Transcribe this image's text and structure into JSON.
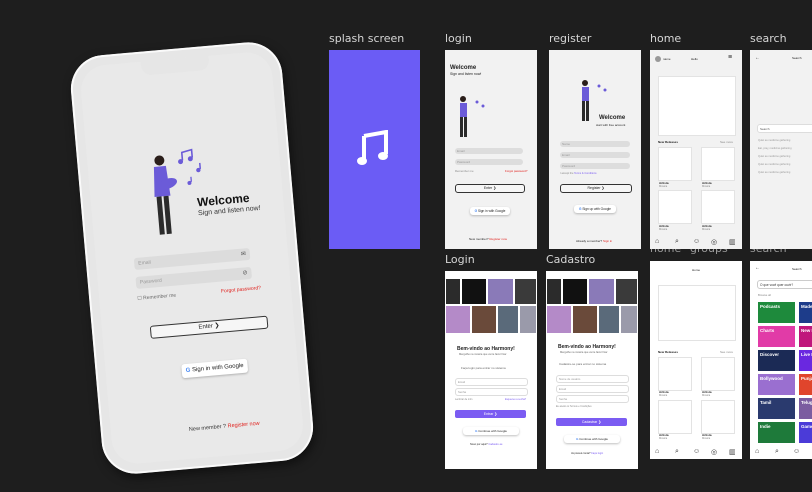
{
  "frame_labels": {
    "splash": "splash screen",
    "login": "login",
    "register": "register",
    "home": "home",
    "search": "search",
    "login2": "Login",
    "cadastro": "Cadastro",
    "home2": "home",
    "groups": "groups",
    "search2": "search"
  },
  "phone": {
    "welcome": "Welcome",
    "subtitle": "Sign and listen now!",
    "email_placeholder": "Email",
    "password_placeholder": "Password",
    "remember": "Remember me",
    "forgot": "Forgot password?",
    "enter": "Enter",
    "google": "Sign in with Google",
    "new_member": "New member ?",
    "register_now": "Register now"
  },
  "login_frame": {
    "welcome": "Welcome",
    "subtitle": "Sign and listen now!",
    "email": "Email",
    "password": "Password",
    "remember": "Remember me",
    "forgot": "Forgot password?",
    "enter": "Enter",
    "google": "Sign in with Google",
    "new_member": "New member?",
    "register_now": "Register now"
  },
  "register_frame": {
    "welcome": "Welcome",
    "subtitle": "start with free account",
    "name": "Name",
    "email": "Email",
    "password": "Password",
    "terms_a": "I accept the",
    "terms_b": "Terms & Conditions",
    "register": "Register",
    "google": "Sign up with Google",
    "already": "Already a member?",
    "signin": "Sign in"
  },
  "home_frame": {
    "user": "name",
    "greeting": "Hello",
    "new_releases": "New Releases",
    "see_more": "See more",
    "artist": "Artista",
    "music": "Música"
  },
  "search_frame": {
    "title": "Search",
    "placeholder": "Search",
    "recent": [
      "Quiet as medicine gathering",
      "Eat, pray, medicine gathering",
      "Quiet as medicine gathering",
      "Quiet as medicine gathering",
      "Quiet as medicine gathering"
    ]
  },
  "login2_frame": {
    "title": "Bem-vindo ao Harmony!",
    "subtitle": "Mergulhe na música que vai te fazer ficar",
    "prompt": "Faça login para entrar no sistema",
    "email": "Email",
    "password": "Senha",
    "remember": "Lembrar de mim",
    "forgot": "Esqueceu a senha?",
    "enter": "Entrar",
    "google": "Continue with Google",
    "new": "Novo por aqui?",
    "register": "Cadastre-se"
  },
  "cadastro_frame": {
    "title": "Bem-vindo ao Harmony!",
    "subtitle": "Mergulhe na música que vai te fazer ficar",
    "prompt": "Cadastre-se para entrar no sistema",
    "name": "Nome de usuário",
    "email": "Email",
    "password": "Senha",
    "terms": "Eu aceito os Termos e Condições",
    "register": "Cadastrar",
    "google": "Continue with Google",
    "already": "Já possui conta?",
    "login": "Faça login"
  },
  "home2_frame": {
    "title": "Home",
    "new_releases": "New Releases",
    "see_more": "See more",
    "artist": "Artista",
    "music": "Música"
  },
  "search2_frame": {
    "title": "Search",
    "question": "O que você quer ouvir?",
    "browse": "Browse all",
    "genres": [
      {
        "name": "Podcasts",
        "color": "#1e8a3c"
      },
      {
        "name": "Made for You",
        "color": "#1d3c8a"
      },
      {
        "name": "Charts",
        "color": "#e13ba7"
      },
      {
        "name": "New Releases",
        "color": "#c0177c"
      },
      {
        "name": "Discover",
        "color": "#1b2a55"
      },
      {
        "name": "Live Events",
        "color": "#6a28e0"
      },
      {
        "name": "Bollywood",
        "color": "#9a6fd0"
      },
      {
        "name": "Punjabi",
        "color": "#e0452c"
      },
      {
        "name": "Tamil",
        "color": "#2a3a6e"
      },
      {
        "name": "Telugu",
        "color": "#7b5ca0"
      },
      {
        "name": "Indie",
        "color": "#1e7a3a"
      },
      {
        "name": "Gamer",
        "color": "#4b3bd8"
      }
    ]
  },
  "colors": {
    "accent": "#7b5cf2",
    "background": "#1e1e1e",
    "danger": "#e0201c"
  }
}
